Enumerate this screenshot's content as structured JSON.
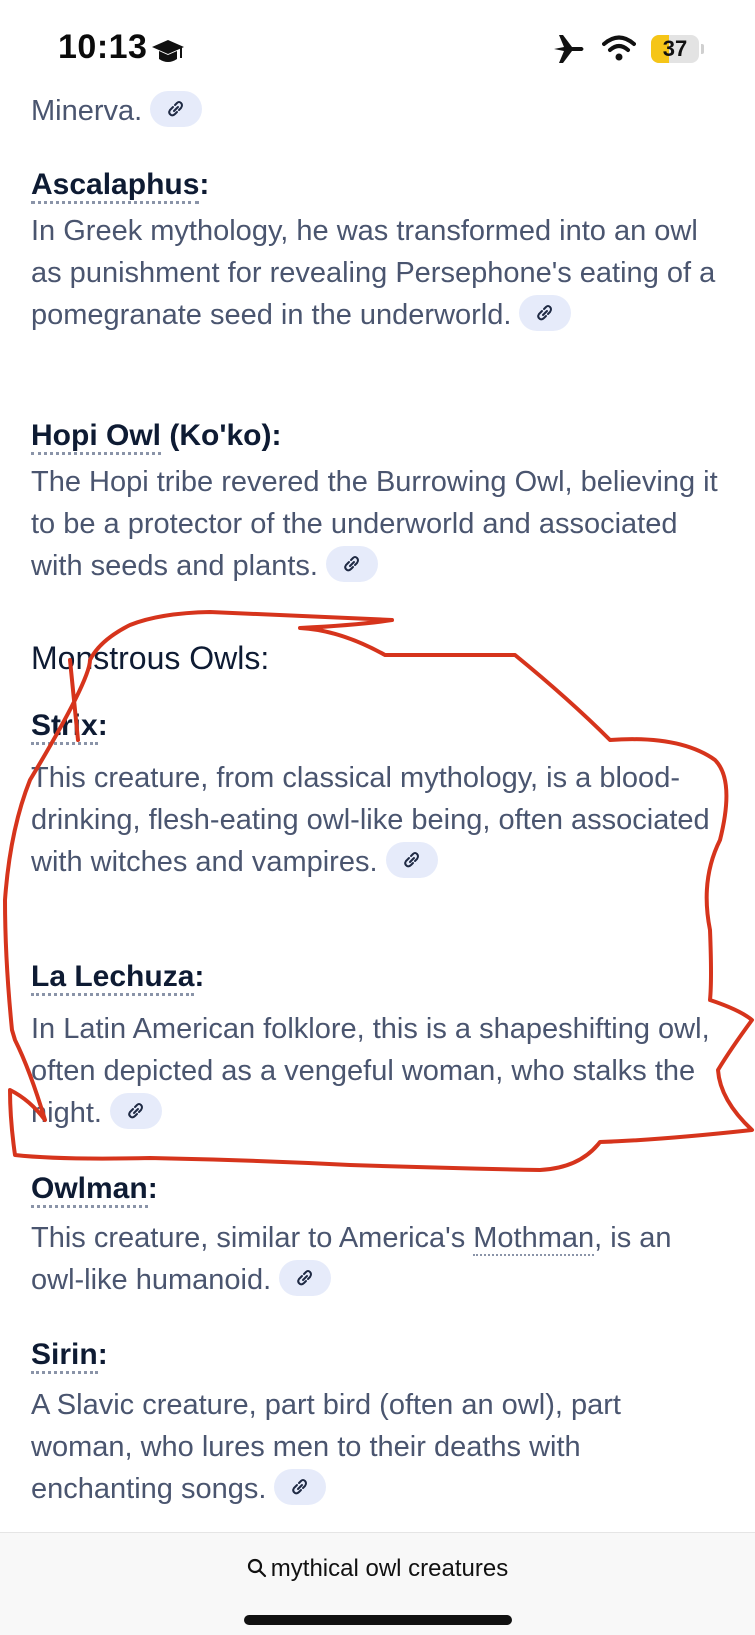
{
  "status_bar": {
    "time": "10:13",
    "battery_percent": "37",
    "battery_level": 0.37,
    "icons": [
      "graduation-cap-icon",
      "airplane-icon",
      "wifi-icon",
      "battery-icon"
    ]
  },
  "entries": [
    {
      "trailing_text": "Minerva."
    },
    {
      "title": "Ascalaphus",
      "title_suffix": ":",
      "body": "In Greek mythology, he was transformed into an owl as punishment for revealing Persephone's eating of a pomegranate seed in the underworld."
    },
    {
      "title": "Hopi Owl",
      "title_suffix": " (Ko'ko):",
      "body": "The Hopi tribe revered the Burrowing Owl, believing it to be a protector of the underworld and associated with seeds and plants."
    }
  ],
  "section": {
    "title": "Monstrous Owls:"
  },
  "monstrous": [
    {
      "title": "Strix",
      "title_suffix": ":",
      "body": "This creature, from classical mythology, is a blood-drinking, flesh-eating owl-like being, often associated with witches and vampires."
    },
    {
      "title": "La Lechuza",
      "title_suffix": ":",
      "body": "In Latin American folklore, this is a shapeshifting owl, often depicted as a vengeful woman, who stalks the night."
    },
    {
      "title": "Owlman",
      "title_suffix": ":",
      "body_pre": "This creature, similar to America's ",
      "body_link": "Mothman",
      "body_post": ", is an owl-like humanoid."
    },
    {
      "title": "Sirin",
      "title_suffix": ":",
      "body": "A Slavic creature, part bird (often an owl), part woman, who lures men to their deaths with enchanting songs."
    }
  ],
  "bottom_bar": {
    "search_query": "mythical owl creatures",
    "icon": "search-icon"
  },
  "colors": {
    "scribble": "#d6341c",
    "link_chip_bg": "#e6ebfa",
    "body_text": "#4a556f",
    "heading_text": "#0e1b33"
  }
}
